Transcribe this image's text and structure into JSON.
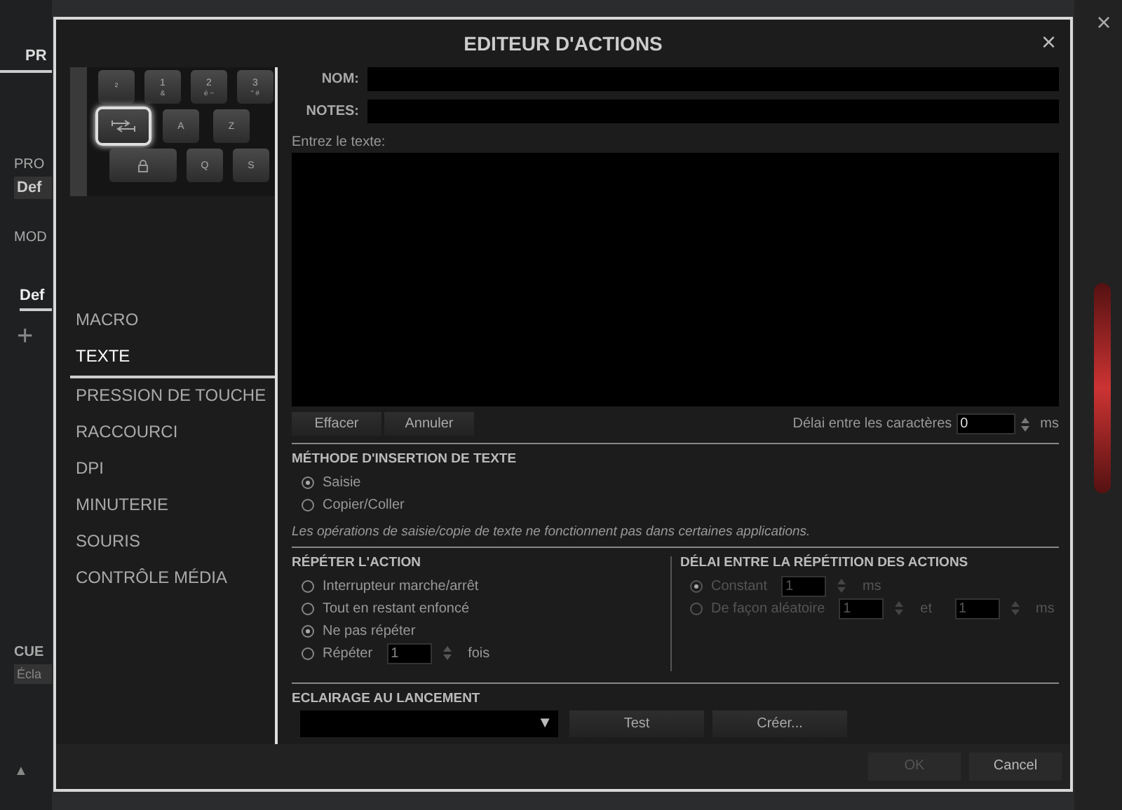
{
  "background_app": {
    "tab": "PR",
    "profile_label": "PRO",
    "profile_value": "Def",
    "mode_label": "MOD",
    "mode_tab": "Def",
    "add_button": "+",
    "cue_label": "CUE",
    "lighting_value": "Écla",
    "expand_button": "▲",
    "close_button": "×"
  },
  "dialog": {
    "title": "EDITEUR D'ACTIONS",
    "close_button": "×",
    "keyboard": [
      [
        {
          "kind": "key",
          "label": "²",
          "selected": false
        },
        {
          "kind": "key",
          "label": "1",
          "sub": "&",
          "selected": false
        },
        {
          "kind": "key",
          "label": "2",
          "sub": "é ~",
          "selected": false
        },
        {
          "kind": "key",
          "label": "3",
          "sub": "\" #",
          "selected": false
        }
      ],
      [
        {
          "kind": "tab",
          "selected": true
        },
        {
          "kind": "key",
          "label": "A",
          "selected": false
        },
        {
          "kind": "key",
          "label": "Z",
          "selected": false
        }
      ],
      [
        {
          "kind": "lock",
          "selected": false
        },
        {
          "kind": "key",
          "label": "Q",
          "selected": false
        },
        {
          "kind": "key",
          "label": "S",
          "selected": false
        }
      ]
    ],
    "menu": [
      {
        "label": "MACRO",
        "selected": false
      },
      {
        "label": "TEXTE",
        "selected": true
      },
      {
        "label": "PRESSION DE TOUCHE",
        "selected": false
      },
      {
        "label": "RACCOURCI",
        "selected": false
      },
      {
        "label": "DPI",
        "selected": false
      },
      {
        "label": "MINUTERIE",
        "selected": false
      },
      {
        "label": "SOURIS",
        "selected": false
      },
      {
        "label": "CONTRÔLE MÉDIA",
        "selected": false
      }
    ],
    "name_field": {
      "label": "NOM:"
    },
    "notes_field": {
      "label": "NOTES:"
    },
    "text_field": {
      "label": "Entrez le texte:"
    },
    "text_buttons": [
      "Effacer",
      "Annuler"
    ],
    "char_delay": {
      "label": "Délai entre les caractères",
      "value": "0",
      "unit": "ms"
    },
    "insertion_method": {
      "title": "MÉTHODE D'INSERTION DE TEXTE",
      "options": [
        {
          "label": "Saisie",
          "selected": true
        },
        {
          "label": "Copier/Coller",
          "selected": false
        }
      ],
      "note": "Les opérations de saisie/copie de texte ne fonctionnent pas dans certaines applications."
    },
    "repeat": {
      "title": "RÉPÉTER L'ACTION",
      "options": [
        {
          "label": "Interrupteur marche/arrêt",
          "selected": false
        },
        {
          "label": "Tout en restant enfoncé",
          "selected": false
        },
        {
          "label": "Ne pas répéter",
          "selected": true
        },
        {
          "label": "Répéter",
          "selected": false,
          "value": "1",
          "unit": "fois"
        }
      ]
    },
    "repeat_delay": {
      "title": "DÉLAI ENTRE LA RÉPÉTITION DES ACTIONS",
      "disabled": true,
      "options": [
        {
          "label": "Constant",
          "selected": true,
          "values": [
            "1"
          ],
          "unit": "ms"
        },
        {
          "label": "De façon aléatoire",
          "selected": false,
          "values": [
            "1",
            "1"
          ],
          "joiner": "et",
          "unit": "ms"
        }
      ]
    },
    "launch_lighting": {
      "title": "ECLAIRAGE AU LANCEMENT",
      "dropdown_arrow": "▼",
      "buttons": [
        "Test",
        "Créer..."
      ]
    },
    "footer_buttons": [
      {
        "label": "OK",
        "disabled": true
      },
      {
        "label": "Cancel",
        "disabled": false
      }
    ]
  }
}
